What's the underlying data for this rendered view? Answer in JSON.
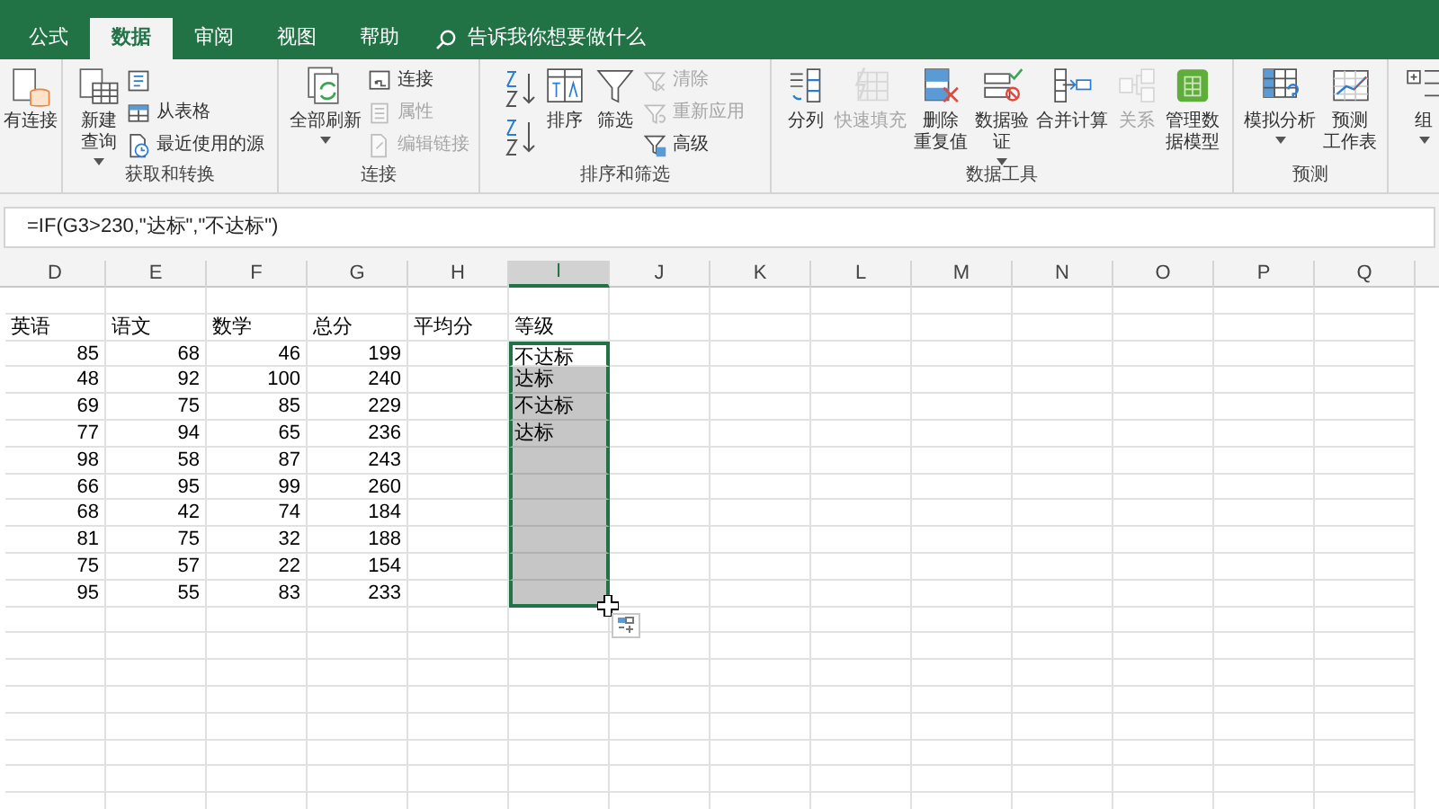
{
  "tabs": [
    {
      "label": "公式",
      "selected": false
    },
    {
      "label": "数据",
      "selected": true
    },
    {
      "label": "审阅",
      "selected": false
    },
    {
      "label": "视图",
      "selected": false
    },
    {
      "label": "帮助",
      "selected": false
    }
  ],
  "tell_me": {
    "text": "告诉我你想要做什么"
  },
  "ribbon": {
    "groups": [
      {
        "buttons": [
          {
            "kind": "large",
            "lines": [
              "有连接"
            ],
            "disabled": false
          }
        ]
      },
      {
        "label": "获取和转换",
        "buttons": [
          {
            "kind": "large",
            "lines": [
              "新建",
              "查询"
            ],
            "disabled": false,
            "dropdown": true
          },
          {
            "kind": "small",
            "disabled": false
          },
          {
            "kind": "small",
            "label": "从表格",
            "disabled": false
          },
          {
            "kind": "small",
            "label": "最近使用的源",
            "disabled": false
          }
        ]
      },
      {
        "label": "连接",
        "buttons": [
          {
            "kind": "large",
            "lines": [
              "全部刷新"
            ],
            "disabled": false,
            "dropdown": true
          },
          {
            "kind": "small",
            "label": "连接",
            "disabled": false
          },
          {
            "kind": "small",
            "label": "属性",
            "disabled": true
          },
          {
            "kind": "small",
            "label": "编辑链接",
            "disabled": true
          }
        ]
      },
      {
        "label": "排序和筛选",
        "buttons": [
          {
            "kind": "sort",
            "disabled": false
          },
          {
            "kind": "sort",
            "disabled": false
          },
          {
            "kind": "large",
            "lines": [
              "排序"
            ],
            "disabled": false
          },
          {
            "kind": "large",
            "lines": [
              "筛选"
            ],
            "disabled": false
          },
          {
            "kind": "small",
            "label": "清除",
            "disabled": true
          },
          {
            "kind": "small",
            "label": "重新应用",
            "disabled": true
          },
          {
            "kind": "small",
            "label": "高级",
            "disabled": false
          }
        ]
      },
      {
        "label": "数据工具",
        "buttons": [
          {
            "kind": "large",
            "lines": [
              "分列"
            ],
            "disabled": false
          },
          {
            "kind": "large",
            "lines": [
              "快速填充"
            ],
            "disabled": true
          },
          {
            "kind": "large",
            "lines": [
              "删除",
              "重复值"
            ],
            "disabled": false
          },
          {
            "kind": "large",
            "lines": [
              "数据验",
              "证"
            ],
            "disabled": false,
            "dropdown": true
          },
          {
            "kind": "large",
            "lines": [
              "合并计算"
            ],
            "disabled": false
          },
          {
            "kind": "large",
            "lines": [
              "关系"
            ],
            "disabled": true
          },
          {
            "kind": "large",
            "lines": [
              "管理数",
              "据模型"
            ],
            "disabled": false
          }
        ]
      },
      {
        "label": "预测",
        "buttons": [
          {
            "kind": "large",
            "lines": [
              "模拟分析"
            ],
            "disabled": false,
            "dropdown": true
          },
          {
            "kind": "large",
            "lines": [
              "预测",
              "工作表"
            ],
            "disabled": false
          }
        ]
      },
      {
        "buttons": [
          {
            "kind": "large",
            "lines": [
              "组"
            ],
            "disabled": false,
            "dropdown": true
          }
        ]
      }
    ]
  },
  "formula_bar": {
    "formula": "=IF(G3>230,\"达标\",\"不达标\")"
  },
  "sheet": {
    "columns": [
      {
        "label": "D",
        "selected": false
      },
      {
        "label": "E",
        "selected": false
      },
      {
        "label": "F",
        "selected": false
      },
      {
        "label": "G",
        "selected": false
      },
      {
        "label": "H",
        "selected": false
      },
      {
        "label": "I",
        "selected": true
      },
      {
        "label": "J",
        "selected": false
      },
      {
        "label": "K",
        "selected": false
      },
      {
        "label": "L",
        "selected": false
      },
      {
        "label": "M",
        "selected": false
      },
      {
        "label": "N",
        "selected": false
      },
      {
        "label": "O",
        "selected": false
      },
      {
        "label": "P",
        "selected": false
      },
      {
        "label": "Q",
        "selected": false
      }
    ],
    "headers": [
      "英语",
      "语文",
      "数学",
      "总分",
      "平均分",
      "等级"
    ],
    "rows": [
      {
        "cells": [
          "85",
          "68",
          "46",
          "199"
        ],
        "grade": "不达标",
        "selected": true,
        "active": true
      },
      {
        "cells": [
          "48",
          "92",
          "100",
          "240"
        ],
        "grade": "达标",
        "selected": true,
        "active": false
      },
      {
        "cells": [
          "69",
          "75",
          "85",
          "229"
        ],
        "grade": "不达标",
        "selected": true,
        "active": false
      },
      {
        "cells": [
          "77",
          "94",
          "65",
          "236"
        ],
        "grade": "达标",
        "selected": true,
        "active": false
      },
      {
        "cells": [
          "98",
          "58",
          "87",
          "243"
        ],
        "selected": true,
        "active": false
      },
      {
        "cells": [
          "66",
          "95",
          "99",
          "260"
        ],
        "selected": true,
        "active": false
      },
      {
        "cells": [
          "68",
          "42",
          "74",
          "184"
        ],
        "selected": true,
        "active": false
      },
      {
        "cells": [
          "81",
          "75",
          "32",
          "188"
        ],
        "selected": true,
        "active": false
      },
      {
        "cells": [
          "75",
          "57",
          "22",
          "154"
        ],
        "selected": true,
        "active": false
      },
      {
        "cells": [
          "95",
          "55",
          "83",
          "233"
        ],
        "selected": true,
        "active": false
      }
    ]
  }
}
